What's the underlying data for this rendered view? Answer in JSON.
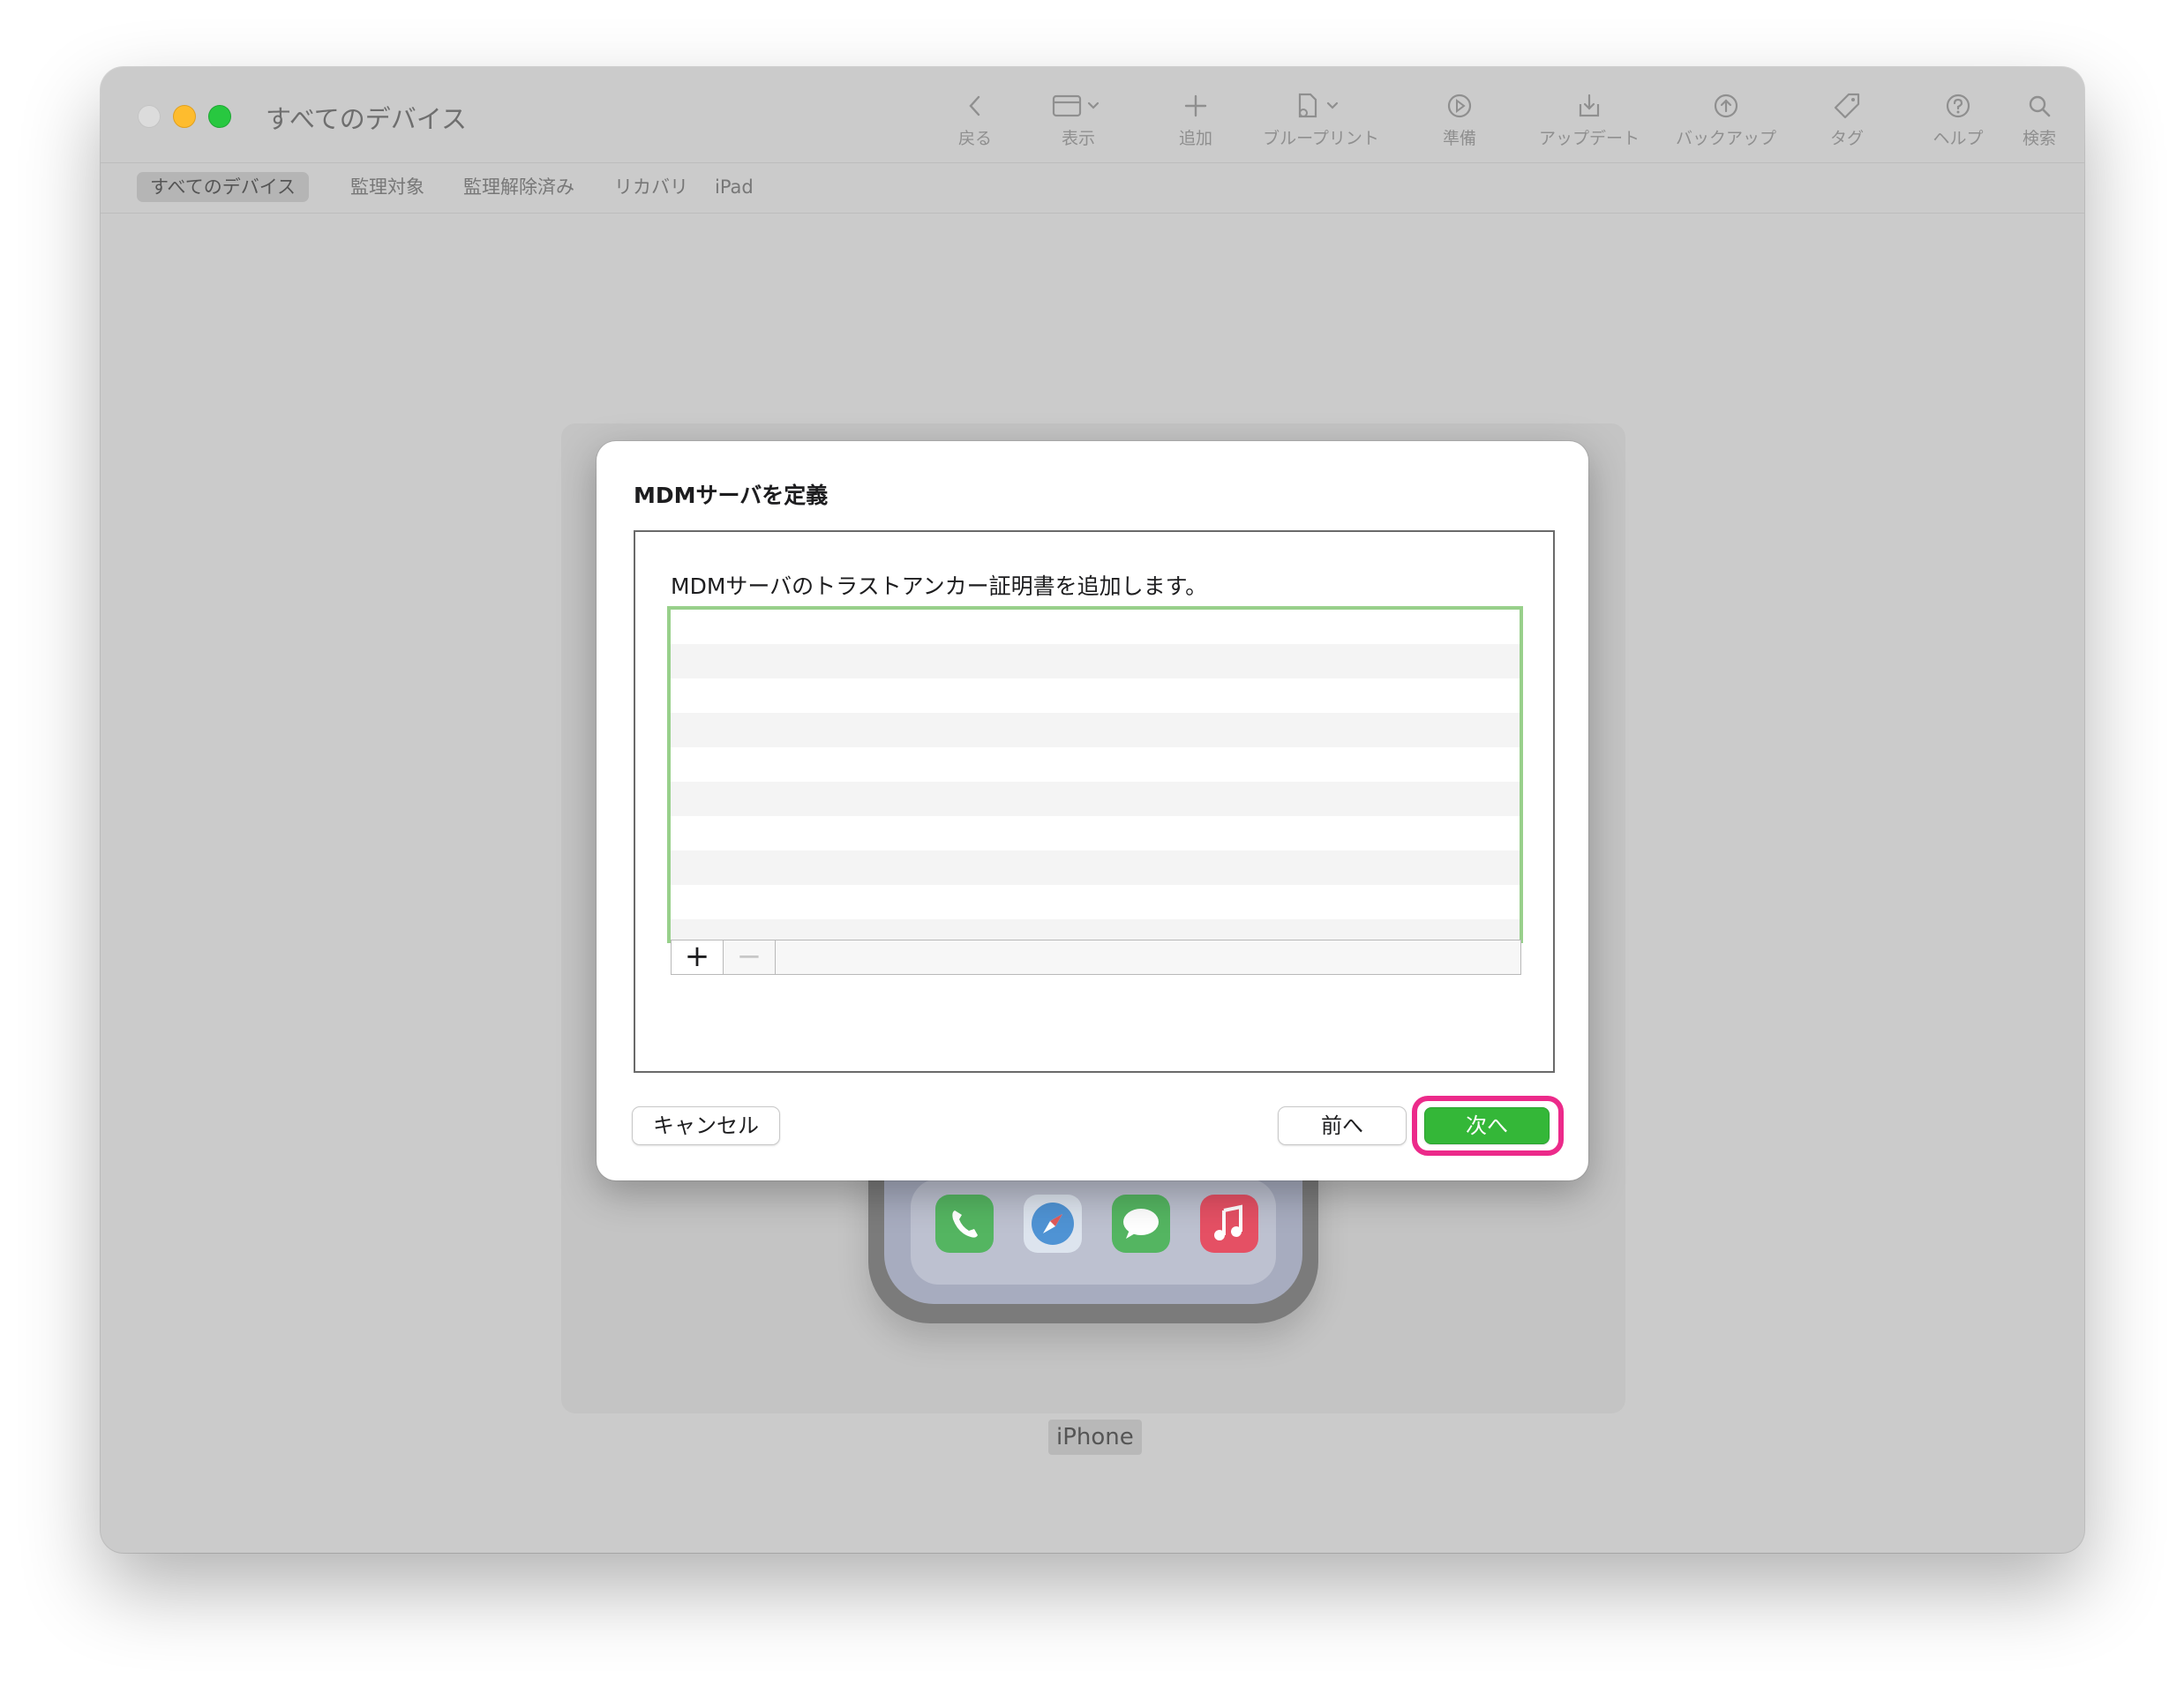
{
  "window": {
    "title": "すべてのデバイス"
  },
  "toolbar": [
    {
      "name": "back",
      "label": "戻る"
    },
    {
      "name": "view",
      "label": "表示"
    },
    {
      "name": "add",
      "label": "追加"
    },
    {
      "name": "blueprint",
      "label": "ブループリント"
    },
    {
      "name": "prepare",
      "label": "準備"
    },
    {
      "name": "update",
      "label": "アップデート"
    },
    {
      "name": "backup",
      "label": "バックアップ"
    },
    {
      "name": "tag",
      "label": "タグ"
    },
    {
      "name": "help",
      "label": "ヘルプ"
    },
    {
      "name": "search",
      "label": "検索"
    }
  ],
  "scope": {
    "selected": "すべてのデバイス",
    "items": [
      "すべてのデバイス",
      "監理対象",
      "監理解除済み",
      "リカバリ",
      "iPad"
    ]
  },
  "device": {
    "label": "iPhone"
  },
  "dialog": {
    "title": "MDMサーバを定義",
    "description": "MDMサーバのトラストアンカー証明書を追加します。",
    "list_add": "+",
    "list_remove": "−",
    "cancel": "キャンセル",
    "back": "前へ",
    "next": "次へ"
  },
  "colors": {
    "highlight": "#ec2a8a",
    "list_focus": "#98d08b",
    "primary_button": "#34b738"
  }
}
